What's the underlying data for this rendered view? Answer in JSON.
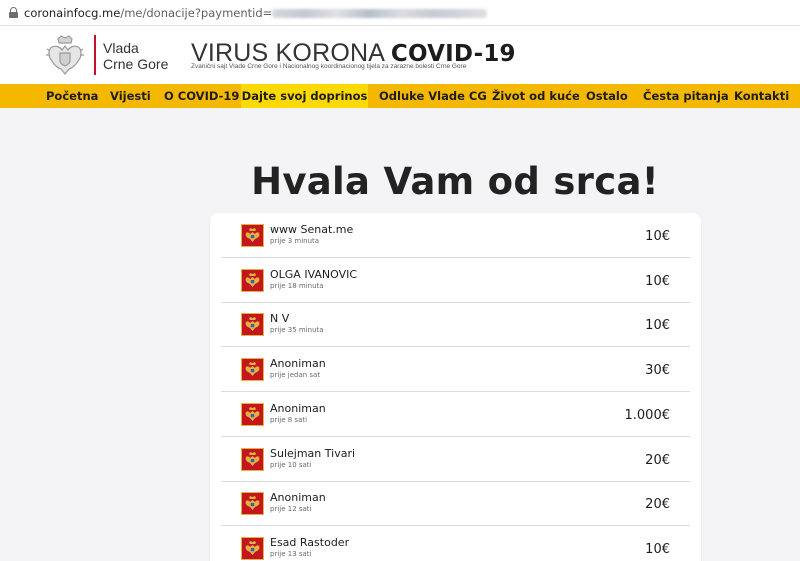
{
  "browser": {
    "url_domain": "coronainfocg.me",
    "url_path": "/me/donacije?paymentid="
  },
  "header": {
    "gov_line1": "Vlada",
    "gov_line2": "Crne Gore",
    "title_light": "VIRUS KORONA",
    "title_bold": "COVID-19",
    "subtitle": "Zvanični sajt Vlade Crne Gore i Nacionalnog koordinacionog tijela za zarazne bolesti Crne Gore"
  },
  "nav": {
    "items": [
      {
        "label": "Početna"
      },
      {
        "label": "Vijesti"
      },
      {
        "label": "O COVID-19"
      },
      {
        "label": "Dajte svoj doprinos",
        "active": true
      },
      {
        "label": "Odluke Vlade CG"
      },
      {
        "label": "Život od kuće"
      },
      {
        "label": "Ostalo"
      },
      {
        "label": "Česta pitanja"
      },
      {
        "label": "Kontakti"
      }
    ]
  },
  "main": {
    "heading": "Hvala Vam od srca!",
    "donations": [
      {
        "name": "www Senat.me",
        "time": "prije 3 minuta",
        "amount": "10€"
      },
      {
        "name": "OLGA IVANOVIC",
        "time": "prije 18 minuta",
        "amount": "10€"
      },
      {
        "name": "N V",
        "time": "prije 35 minuta",
        "amount": "10€"
      },
      {
        "name": "Anoniman",
        "time": "prije jedan sat",
        "amount": "30€"
      },
      {
        "name": "Anoniman",
        "time": "prije 8 sati",
        "amount": "1.000€"
      },
      {
        "name": "Sulejman Tivari",
        "time": "prije 10 sati",
        "amount": "20€"
      },
      {
        "name": "Anoniman",
        "time": "prije 12 sati",
        "amount": "20€"
      },
      {
        "name": "Esad Rastoder",
        "time": "prije 13 sati",
        "amount": "10€"
      }
    ]
  },
  "colors": {
    "nav_bg": "#f5b800",
    "nav_active": "#fcd900",
    "accent_red": "#c8102e",
    "flag_red": "#c4161c",
    "flag_gold": "#e3b341"
  },
  "icons": {
    "address_bar": "lock-icon",
    "header_logo": "coat-of-arms-icon",
    "donation_row": "montenegro-flag-icon"
  }
}
